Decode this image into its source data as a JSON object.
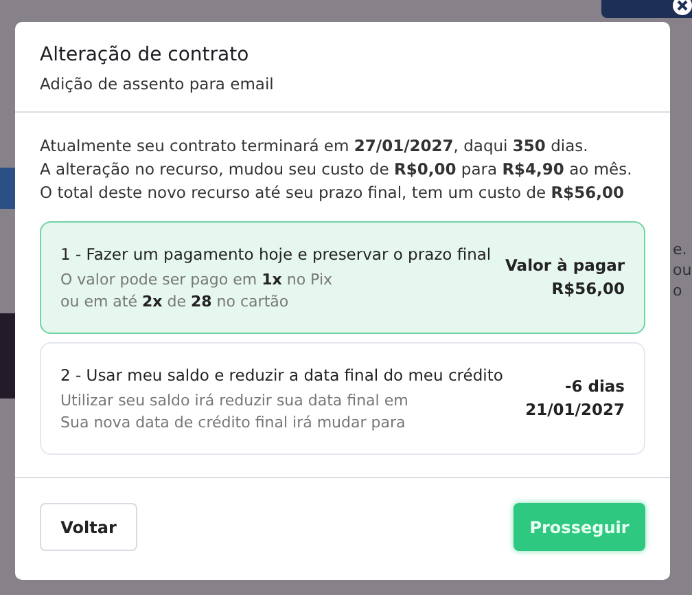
{
  "background": {
    "fragments": [
      "e.",
      "ou",
      "o"
    ]
  },
  "modal": {
    "title": "Alteração de contrato",
    "subtitle": "Adição de assento para email",
    "summary": [
      "Atualmente seu contrato terminará em **27/01/2027**, daqui **350** dias.",
      "A alteração no recurso, mudou seu custo de **R$0,00** para **R$4,90** ao mês.",
      "O total deste novo recurso até seu prazo final, tem um custo de **R$56,00**"
    ],
    "options": [
      {
        "title": "1 - Fazer um pagamento hoje e preservar o prazo final",
        "lines": [
          "O valor pode ser pago em **1x** no Pix",
          "ou em até **2x** de **28** no cartão"
        ],
        "values": [
          "Valor à pagar",
          "R$56,00"
        ],
        "selected": true
      },
      {
        "title": "2 - Usar meu saldo e reduzir a data final do meu crédito",
        "lines": [
          "Utilizar seu saldo irá reduzir sua data final em",
          "Sua nova data de crédito final irá mudar para"
        ],
        "values": [
          "-6 dias",
          "21/01/2027"
        ],
        "selected": false
      }
    ],
    "buttons": [
      {
        "label": "Voltar",
        "kind": "secondary"
      },
      {
        "label": "Prosseguir",
        "kind": "primary"
      }
    ]
  }
}
